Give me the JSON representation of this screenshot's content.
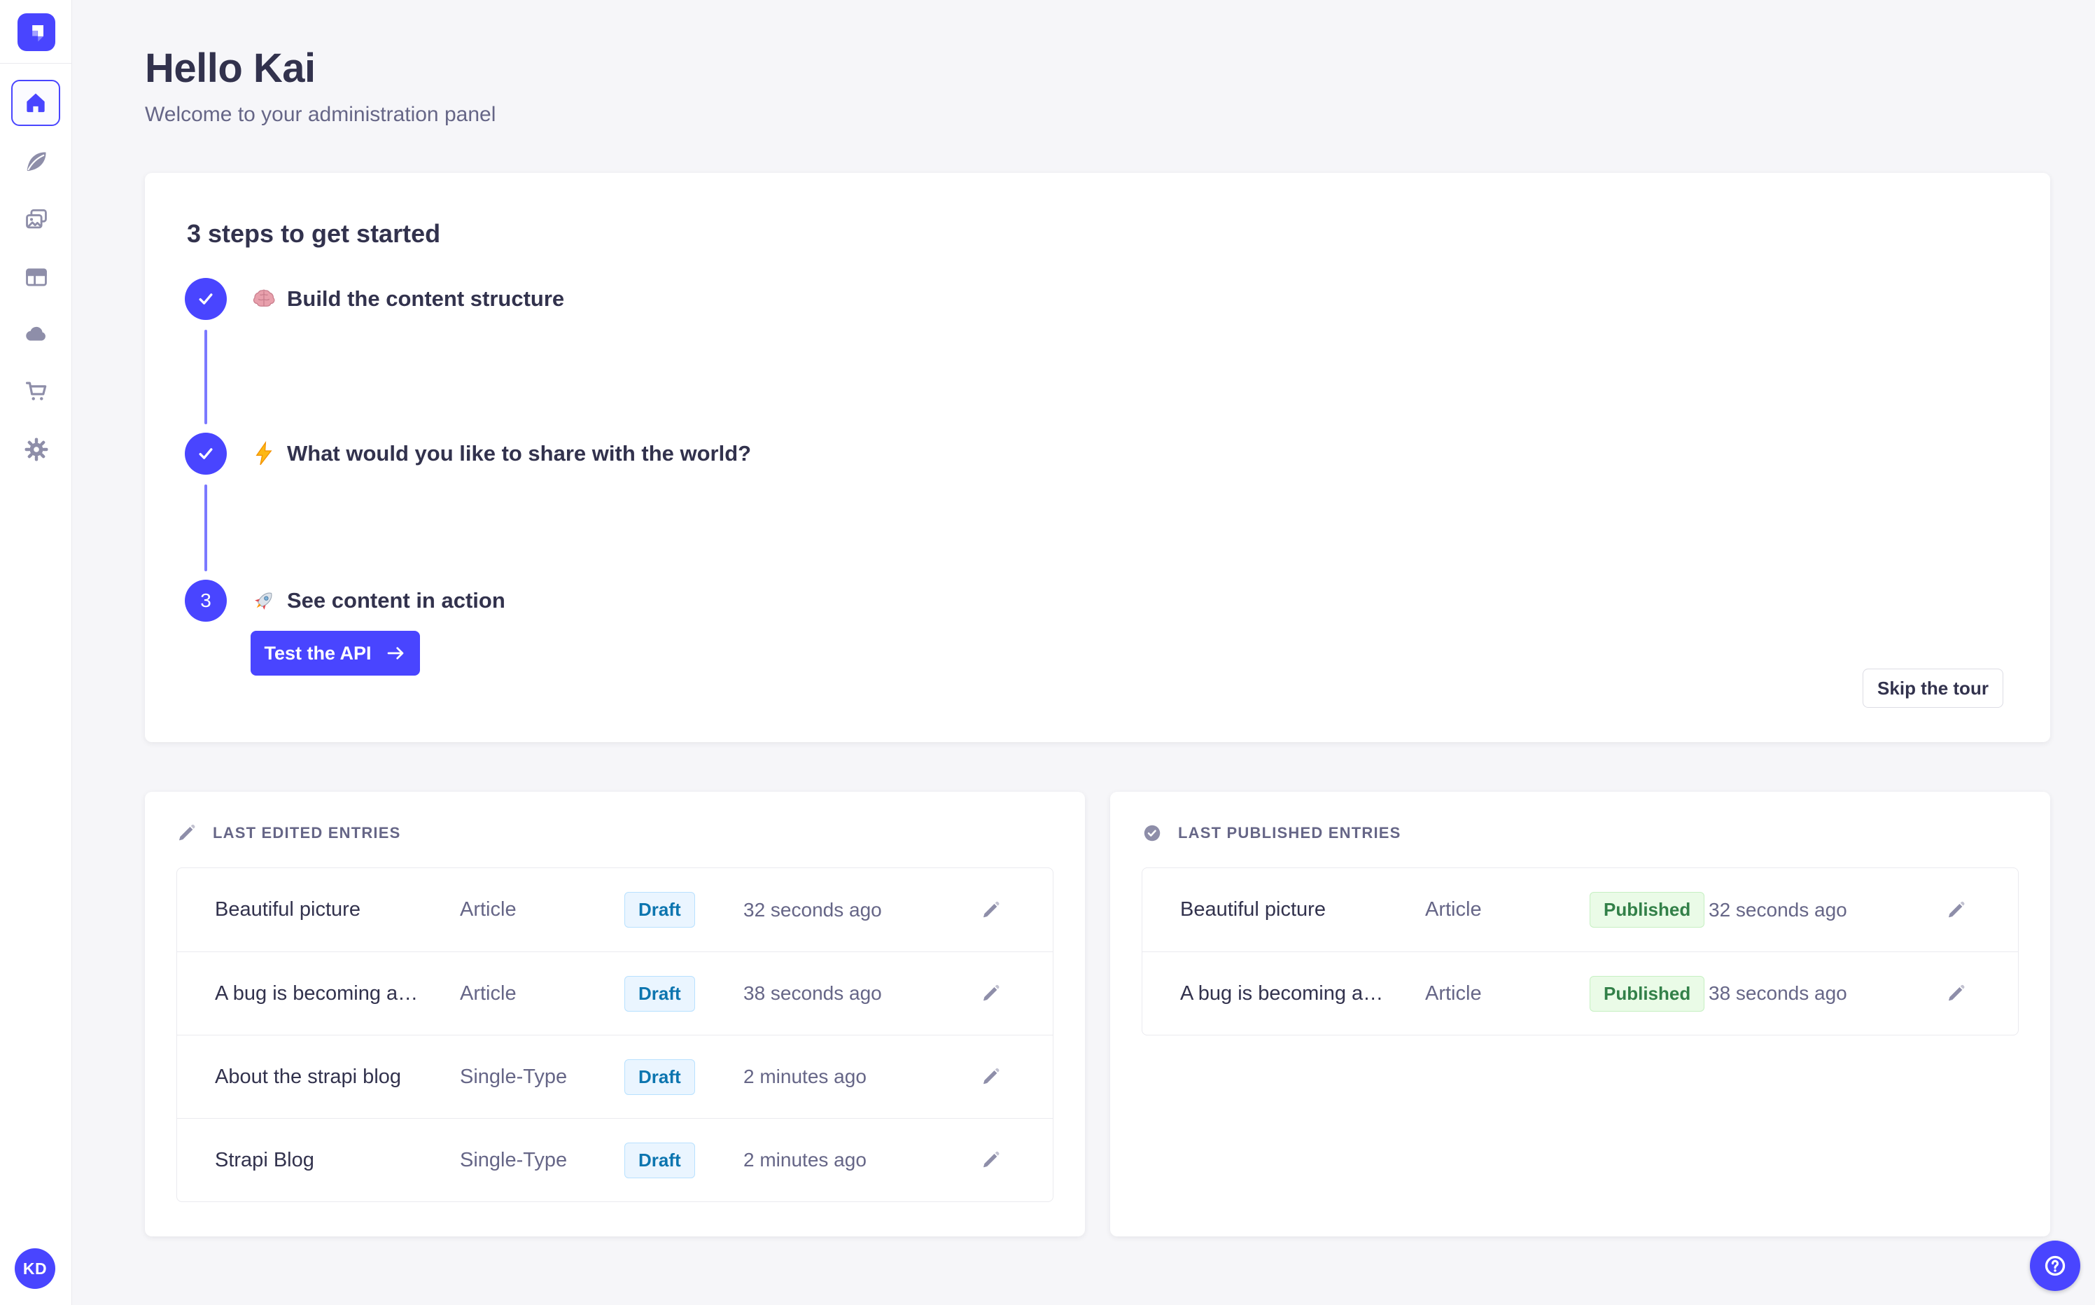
{
  "header": {
    "title": "Hello Kai",
    "subtitle": "Welcome to your administration panel"
  },
  "sidebar": {
    "avatar_initials": "KD",
    "icons": [
      "strapi-logo",
      "home",
      "content-manager",
      "media-library",
      "content-type-builder",
      "cloud",
      "marketplace",
      "settings"
    ]
  },
  "onboarding": {
    "title": "3 steps to get started",
    "steps": [
      {
        "status": "done",
        "emoji": "🧠",
        "label": "Build the content structure"
      },
      {
        "status": "done",
        "emoji": "⚡",
        "label": "What would you like to share with the world?"
      },
      {
        "status": "current",
        "number": "3",
        "emoji": "🚀",
        "label": "See content in action",
        "cta_label": "Test the API"
      }
    ],
    "skip_label": "Skip the tour"
  },
  "last_edited": {
    "header": "LAST EDITED ENTRIES",
    "rows": [
      {
        "title": "Beautiful picture",
        "type": "Article",
        "status": "Draft",
        "time": "32 seconds ago"
      },
      {
        "title": "A bug is becoming a…",
        "type": "Article",
        "status": "Draft",
        "time": "38 seconds ago"
      },
      {
        "title": "About the strapi blog",
        "type": "Single-Type",
        "status": "Draft",
        "time": "2 minutes ago"
      },
      {
        "title": "Strapi Blog",
        "type": "Single-Type",
        "status": "Draft",
        "time": "2 minutes ago"
      }
    ]
  },
  "last_published": {
    "header": "LAST PUBLISHED ENTRIES",
    "rows": [
      {
        "title": "Beautiful picture",
        "type": "Article",
        "status": "Published",
        "time": "32 seconds ago"
      },
      {
        "title": "A bug is becoming a…",
        "type": "Article",
        "status": "Published",
        "time": "38 seconds ago"
      }
    ]
  },
  "colors": {
    "accent": "#4945ff",
    "background": "#f6f6f9",
    "draft_bg": "#eaf5ff",
    "draft_border": "#b8e1ff",
    "draft_text": "#0c75af",
    "published_bg": "#eafbe7",
    "published_border": "#c6f0c2",
    "published_text": "#328048",
    "text_dark": "#32324d",
    "text_muted": "#666687"
  }
}
